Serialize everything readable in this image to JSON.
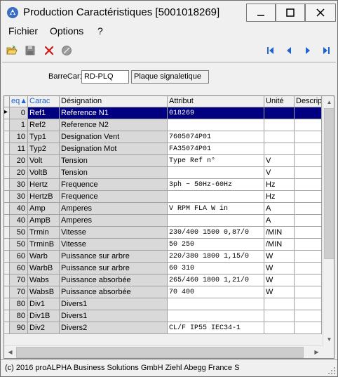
{
  "window": {
    "title": "Production Caractéristiques  [5001018269]",
    "minimize_label": "—",
    "maximize_label": "☐",
    "close_label": "✕"
  },
  "menu": {
    "items": [
      {
        "label": "Fichier"
      },
      {
        "label": "Options"
      },
      {
        "label": "?"
      }
    ]
  },
  "toolbar": {
    "icons": [
      "open-folder-icon",
      "save-icon",
      "delete-icon",
      "cancel-icon"
    ],
    "nav_icons": [
      "first-record-icon",
      "previous-record-icon",
      "next-record-icon",
      "last-record-icon"
    ]
  },
  "barrecar": {
    "label": "BarreCar:",
    "value": "RD-PLQ",
    "description": "Plaque signaletique"
  },
  "grid": {
    "columns": [
      "eq",
      "Carac",
      "Désignation",
      "Attribut",
      "Unité",
      "Descript"
    ],
    "rows": [
      {
        "seq": "0",
        "carac": "Ref1",
        "designation": "Reference N1",
        "attribut": "018269",
        "unite": "",
        "selected": true
      },
      {
        "seq": "1",
        "carac": "Ref2",
        "designation": "Reference N2",
        "attribut": "",
        "unite": ""
      },
      {
        "seq": "10",
        "carac": "Typ1",
        "designation": "Designation Vent",
        "attribut": "7605074P01",
        "unite": ""
      },
      {
        "seq": "11",
        "carac": "Typ2",
        "designation": "Designation Mot",
        "attribut": "FA35074P01",
        "unite": ""
      },
      {
        "seq": "20",
        "carac": "Volt",
        "designation": "Tension",
        "attribut": "Type Ref n°",
        "unite": "V"
      },
      {
        "seq": "20",
        "carac": "VoltB",
        "designation": "Tension",
        "attribut": "",
        "unite": "V"
      },
      {
        "seq": "30",
        "carac": "Hertz",
        "designation": "Frequence",
        "attribut": "3ph ~ 50Hz-60Hz",
        "unite": "Hz"
      },
      {
        "seq": "30",
        "carac": "HertzB",
        "designation": "Frequence",
        "attribut": "",
        "unite": "Hz"
      },
      {
        "seq": "40",
        "carac": "Amp",
        "designation": "Amperes",
        "attribut": "V RPM FLA W in",
        "unite": "A"
      },
      {
        "seq": "40",
        "carac": "AmpB",
        "designation": "Amperes",
        "attribut": "",
        "unite": "A"
      },
      {
        "seq": "50",
        "carac": "Trmin",
        "designation": "Vitesse",
        "attribut": "230/400 1500 0,87/0",
        "unite": "/MIN"
      },
      {
        "seq": "50",
        "carac": "TrminB",
        "designation": "Vitesse",
        "attribut": "50 250",
        "unite": "/MIN"
      },
      {
        "seq": "60",
        "carac": "Warb",
        "designation": "Puissance sur arbre",
        "attribut": "220/380 1800 1,15/0",
        "unite": "W"
      },
      {
        "seq": "60",
        "carac": "WarbB",
        "designation": "Puissance sur arbre",
        "attribut": "60 310",
        "unite": "W"
      },
      {
        "seq": "70",
        "carac": "Wabs",
        "designation": "Puissance absorbée",
        "attribut": "265/460 1800 1,21/0",
        "unite": "W"
      },
      {
        "seq": "70",
        "carac": "WabsB",
        "designation": "Puissance absorbée",
        "attribut": "70 400",
        "unite": "W"
      },
      {
        "seq": "80",
        "carac": "Div1",
        "designation": "Divers1",
        "attribut": "",
        "unite": ""
      },
      {
        "seq": "80",
        "carac": "Div1B",
        "designation": "Divers1",
        "attribut": "",
        "unite": ""
      },
      {
        "seq": "90",
        "carac": "Div2",
        "designation": "Divers2",
        "attribut": "CL/F IP55 IEC34-1",
        "unite": ""
      }
    ]
  },
  "status": {
    "text": "(c) 2016 proALPHA Business Solutions GmbH  Ziehl Abegg France S"
  },
  "colors": {
    "selection": "#000080",
    "nav_arrow": "#1e64d2",
    "delete_red": "#cc1a1a"
  }
}
